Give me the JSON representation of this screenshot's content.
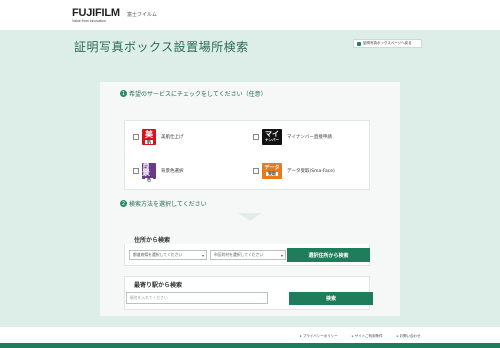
{
  "header": {
    "logo_main": "FUJIFILM",
    "logo_tagline": "Value from Innovation",
    "company": "富士フイルム"
  },
  "page": {
    "title": "証明写真ボックス設置場所検索",
    "store_link": "証明写真ボックスページへ戻る"
  },
  "step1": {
    "number": "1",
    "label": "希望のサービスにチェックをしてください（任意）",
    "services": [
      {
        "badge_top": "美",
        "badge_bottom": "肌",
        "label": "美肌仕上げ",
        "color": "#d8121a"
      },
      {
        "badge_top": "マイ",
        "badge_bottom": "ナンバー",
        "label": "マイナンバー直接申請",
        "color": "#111111"
      },
      {
        "badge_top": "背景",
        "badge_bottom": "色",
        "label": "背景色選択",
        "color": "#6b3a8c"
      },
      {
        "badge_top": "データ",
        "badge_bottom": "受取",
        "label": "データ受取(Sma-Face)",
        "color": "#e97a1b"
      }
    ]
  },
  "step2": {
    "number": "2",
    "label": "検索方法を選択してください"
  },
  "address_search": {
    "title": "住所から検索",
    "prefecture_select": "都道府県を選択してください",
    "city_select": "市区町村を選択してください",
    "button": "選択住所から検索"
  },
  "station_search": {
    "title": "最寄り駅から検索",
    "placeholder": "駅名を入れてください",
    "button": "検索"
  },
  "footer": {
    "links": [
      "プライバシーポリシー",
      "サイトご利用条件",
      "お問い合わせ"
    ]
  },
  "colors": {
    "background": "#ddeee9",
    "accent": "#1e7d5a",
    "title": "#2c6b54"
  }
}
